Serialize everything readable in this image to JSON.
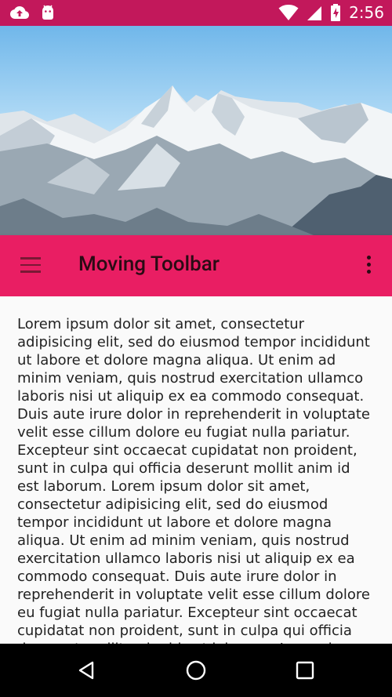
{
  "status_bar": {
    "time": "2:56",
    "icons": [
      "cloud-upload-icon",
      "android-icon",
      "wifi-icon",
      "signal-icon",
      "battery-charging-icon"
    ]
  },
  "toolbar": {
    "title": "Moving Toolbar",
    "menu_icon": "hamburger-menu-icon",
    "overflow_icon": "more-vert-icon"
  },
  "content": {
    "text": "Lorem ipsum dolor sit amet, consectetur adipisicing elit, sed do eiusmod tempor incididunt ut labore et dolore magna aliqua. Ut enim ad minim veniam, quis nostrud exercitation ullamco laboris nisi ut aliquip ex ea commodo consequat. Duis aute irure dolor in reprehenderit in voluptate velit esse cillum dolore eu fugiat nulla pariatur. Excepteur sint occaecat cupidatat non proident, sunt in culpa qui officia deserunt mollit anim id est laborum. Lorem ipsum dolor sit amet, consectetur adipisicing elit, sed do eiusmod tempor incididunt ut labore et dolore magna aliqua. Ut enim ad minim veniam, quis nostrud exercitation ullamco laboris nisi ut aliquip ex ea commodo consequat. Duis aute irure dolor in reprehenderit in voluptate velit esse cillum dolore eu fugiat nulla pariatur. Excepteur sint occaecat cupidatat non proident, sunt in culpa qui officia deserunt mollit anim id est laborum. Lorem ipsum dolor sit amet, consectetur adipisicing elit, sed do eiusmod tempor"
  },
  "nav_bar": {
    "buttons": [
      "back-icon",
      "home-icon",
      "recents-icon"
    ]
  },
  "colors": {
    "status_bar": "#c2185b",
    "toolbar": "#e91e63",
    "nav_bar": "#000000"
  }
}
